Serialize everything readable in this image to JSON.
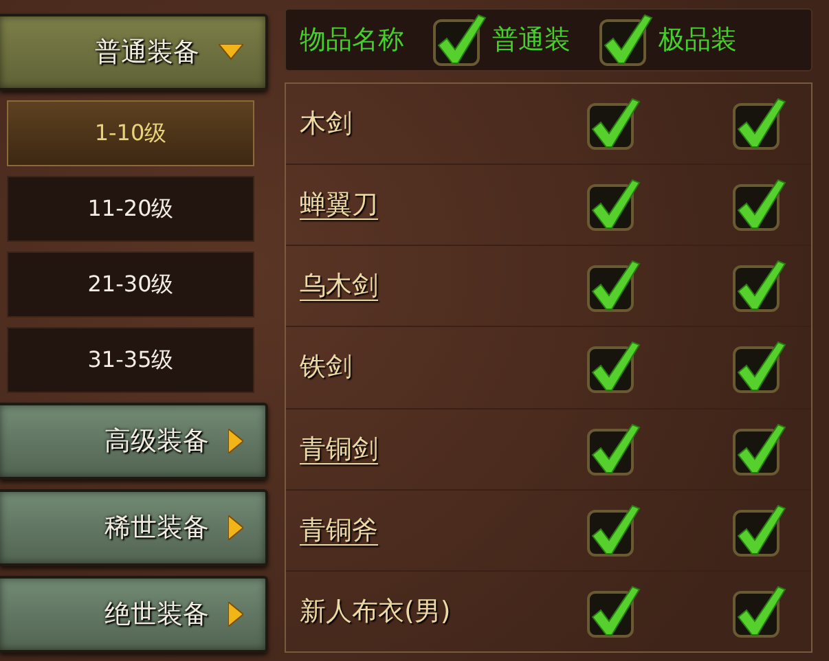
{
  "categories": [
    {
      "label": "普通装备",
      "expanded": true,
      "levels": [
        {
          "label": "1-10级",
          "selected": true
        },
        {
          "label": "11-20级",
          "selected": false
        },
        {
          "label": "21-30级",
          "selected": false
        },
        {
          "label": "31-35级",
          "selected": false
        }
      ]
    },
    {
      "label": "高级装备",
      "expanded": false
    },
    {
      "label": "稀世装备",
      "expanded": false
    },
    {
      "label": "绝世装备",
      "expanded": false
    }
  ],
  "header": {
    "label": "物品名称",
    "filters": [
      {
        "label": "普通装",
        "checked": true
      },
      {
        "label": "极品装",
        "checked": true
      }
    ]
  },
  "items": [
    {
      "name": "木剑",
      "link": false,
      "normal": true,
      "premium": true
    },
    {
      "name": "蝉翼刀",
      "link": true,
      "normal": true,
      "premium": true
    },
    {
      "name": "乌木剑",
      "link": true,
      "normal": true,
      "premium": true
    },
    {
      "name": "铁剑",
      "link": false,
      "normal": true,
      "premium": true
    },
    {
      "name": "青铜剑",
      "link": true,
      "normal": true,
      "premium": true
    },
    {
      "name": "青铜斧",
      "link": true,
      "normal": true,
      "premium": true
    },
    {
      "name": "新人布衣(男)",
      "link": false,
      "normal": true,
      "premium": true
    }
  ]
}
